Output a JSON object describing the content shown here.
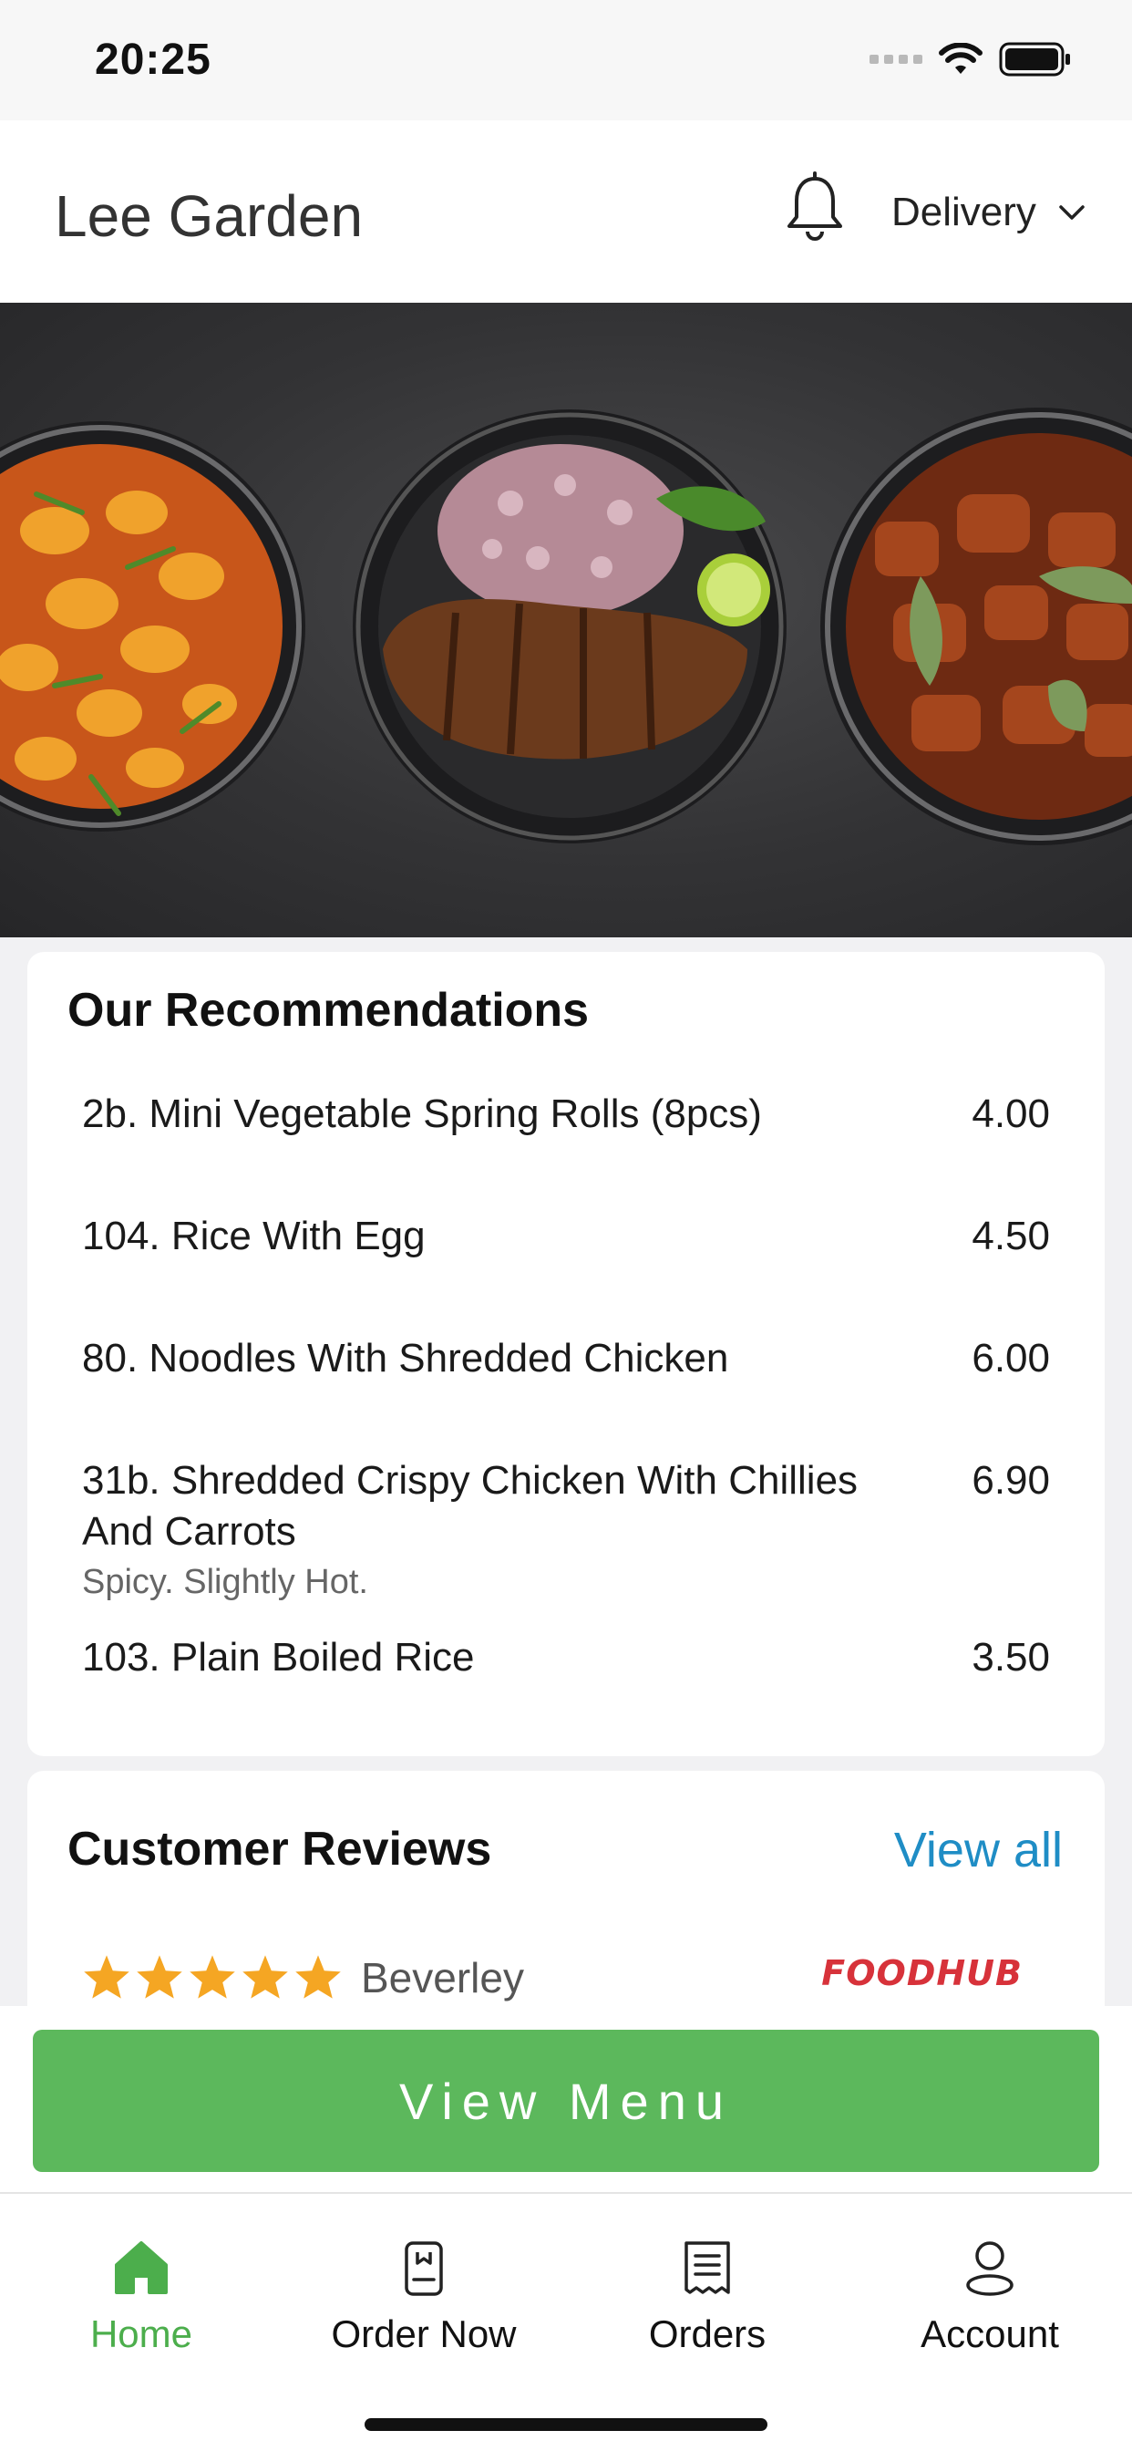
{
  "status_bar": {
    "time": "20:25"
  },
  "header": {
    "title": "Lee Garden",
    "delivery_label": "Delivery"
  },
  "recommendations": {
    "title": "Our Recommendations",
    "items": [
      {
        "name": "2b. Mini Vegetable Spring Rolls (8pcs)",
        "price": "4.00",
        "description": ""
      },
      {
        "name": "104. Rice With Egg",
        "price": "4.50",
        "description": ""
      },
      {
        "name": "80. Noodles With Shredded Chicken",
        "price": "6.00",
        "description": ""
      },
      {
        "name": "31b. Shredded Crispy Chicken With Chillies And Carrots",
        "price": "6.90",
        "description": "Spicy. Slightly Hot."
      },
      {
        "name": "103. Plain Boiled Rice",
        "price": "3.50",
        "description": ""
      }
    ]
  },
  "reviews": {
    "title": "Customer Reviews",
    "view_all_label": "View all",
    "first_review": {
      "rating": 5,
      "reviewer": "Beverley",
      "source": "FOODHUB"
    }
  },
  "view_menu_label": "View Menu",
  "nav": {
    "items": [
      {
        "label": "Home",
        "icon": "home-icon",
        "active": true
      },
      {
        "label": "Order Now",
        "icon": "order-now-icon",
        "active": false
      },
      {
        "label": "Orders",
        "icon": "orders-icon",
        "active": false
      },
      {
        "label": "Account",
        "icon": "account-icon",
        "active": false
      }
    ]
  },
  "colors": {
    "accent_green": "#5cb85c",
    "link_blue": "#1f8dc5",
    "star": "#f5a623",
    "brand_red": "#d7323a"
  }
}
